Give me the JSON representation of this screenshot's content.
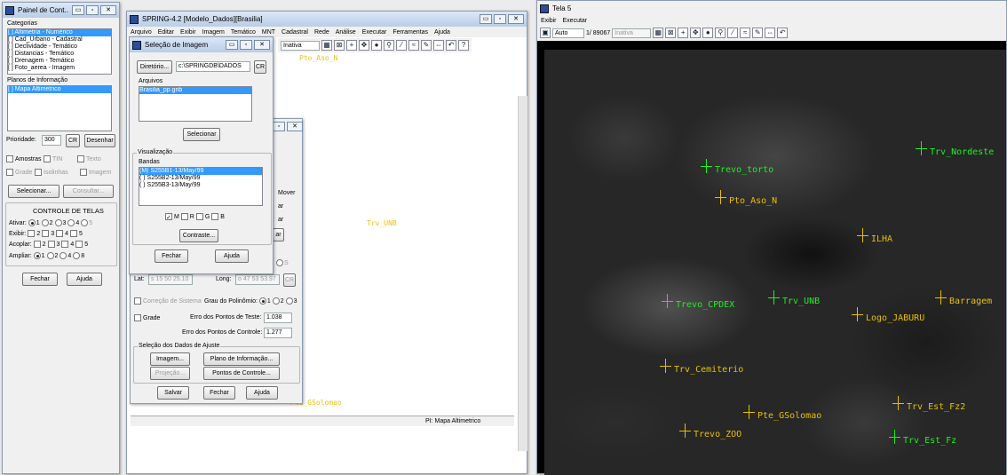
{
  "painel": {
    "title": "Painel de Cont...",
    "categorias_label": "Categorias",
    "categorias": [
      "[ ] Altimetria - Numérico",
      "[ ] Cad_Urbano - Cadastral",
      "[ ] Declividade - Temático",
      "[ ] Distancias - Temático",
      "[ ] Drenagem - Temático",
      "[ ] Foto_aerea - Imagem"
    ],
    "planos_label": "Planos de Informação",
    "planos": [
      "[ ] Mapa Altimetrico"
    ],
    "prioridade_label": "Prioridade:",
    "prioridade_value": "300",
    "cr": "CR",
    "desenhar": "Desenhar",
    "amostras": "Amostras",
    "tin": "TIN",
    "texto": "Texto",
    "grade": "Grade",
    "isolinhas": "Isolinhas",
    "imagem": "Imagem",
    "selecionar": "Selecionar...",
    "consultar": "Consultar...",
    "controle": "CONTROLE DE TELAS",
    "ativar": "Ativar:",
    "exibir": "Exibir:",
    "acoplar": "Acoplar:",
    "ampliar": "Ampliar:",
    "n1": "1",
    "n2": "2",
    "n3": "3",
    "n4": "4",
    "n5": "5",
    "n8": "8",
    "fechar": "Fechar",
    "ajuda": "Ajuda"
  },
  "spring": {
    "title": "SPRING-4.2 [Modelo_Dados][Brasilia]",
    "menu": [
      "Arquivo",
      "Editar",
      "Exibir",
      "Imagem",
      "Temático",
      "MNT",
      "Cadastral",
      "Rede",
      "Análise",
      "Executar",
      "Ferramentas",
      "Ajuda"
    ],
    "inativa": "Inativa",
    "status_pi": "PI: Mapa Altimetrico",
    "marker_pto": "Pto_Aso_N",
    "marker_trv": "Trv_UNB",
    "marker_pte": "Pte_GSolomao"
  },
  "selecao": {
    "title": "Seleção de Imagem",
    "diretorio_btn": "Diretório...",
    "diretorio_value": "c:\\SPRINGDB\\DADOS",
    "cr": "CR",
    "arquivos_label": "Arquivos",
    "arquivos": [
      "Brasilia_pp.grib"
    ],
    "selecionar": "Selecionar",
    "visualizacao": "Visualização",
    "bandas_label": "Bandas",
    "bandas": [
      "(M) S255B1-13/May/99",
      "( ) S255B2-13/May/99",
      "( ) S255B3-13/May/99"
    ],
    "m": "M",
    "r": "R",
    "g": "G",
    "b": "B",
    "contraste": "Contraste...",
    "fechar": "Fechar",
    "ajuda": "Ajuda"
  },
  "registro": {
    "mover": "Mover",
    "ar1": "ar",
    "ar2": "ar",
    "ar3": "ar",
    "radio_s": "S",
    "lat_label": "Lat:",
    "lat_value": "s 15 50 25.10",
    "long_label": "Long:",
    "long_value": "o 47 53 53.97",
    "cr": "CR",
    "correcao": "Correção de Sistema",
    "grau_label": "Grau do Polinômio:",
    "g1": "1",
    "g2": "2",
    "g3": "3",
    "grade": "Grade",
    "erro_teste_label": "Erro dos Pontos de Teste:",
    "erro_teste_value": "1.038",
    "erro_controle_label": "Erro dos Pontos de Controle:",
    "erro_controle_value": "1.277",
    "dados_ajuste": "Seleção dos Dados de Ajuste",
    "imagem": "Imagem...",
    "plano": "Plano de Informação...",
    "projecao": "Projeção...",
    "pontos": "Pontos de Controle...",
    "salvar": "Salvar",
    "fechar": "Fechar",
    "ajuda": "Ajuda"
  },
  "tela5": {
    "title": "Tela 5",
    "menu": [
      "Exibir",
      "Executar"
    ],
    "zoom": "Auto",
    "scale": "1/ 89067",
    "inativa": "Inativa",
    "markers_green": [
      "Trv_Nordeste",
      "Trevo_torto",
      "Trevo_CPDEX",
      "Trv_UNB"
    ],
    "markers_yellow": [
      "Pto_Aso_N",
      "ILHA",
      "Barragem",
      "Logo_JABURU",
      "Trv_Cemiterio",
      "Pte_GSolomao",
      "Trv_Est_Fz2",
      "Trevo_ZOO",
      "Trv_Est_Fz"
    ]
  }
}
